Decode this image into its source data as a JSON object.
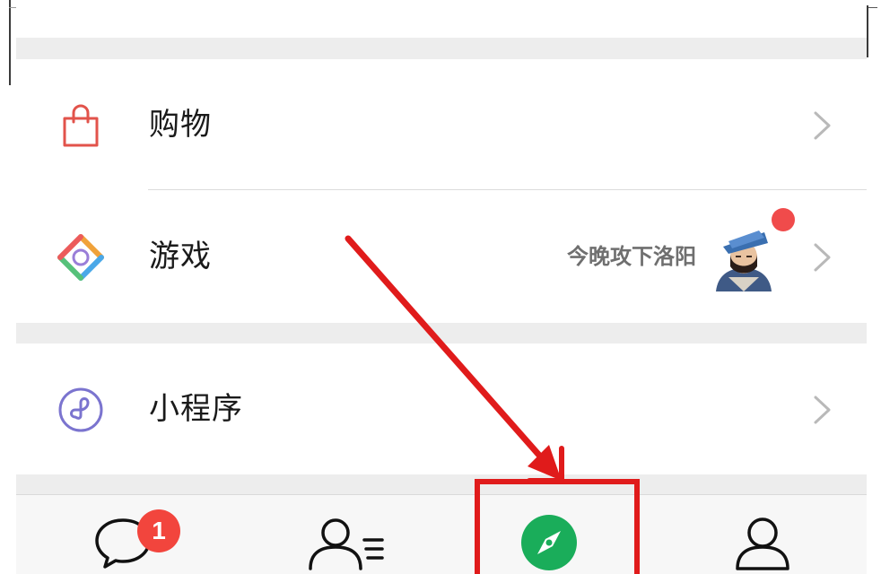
{
  "menu": {
    "items": [
      {
        "label": "购物",
        "icon": "shopping-bag-icon",
        "extra": ""
      },
      {
        "label": "游戏",
        "icon": "game-diamond-icon",
        "extra": "今晚攻下洛阳"
      },
      {
        "label": "小程序",
        "icon": "mini-program-icon",
        "extra": ""
      }
    ]
  },
  "tabbar": {
    "chats_badge": "1",
    "tabs": [
      {
        "icon": "chat-bubble-icon"
      },
      {
        "icon": "contacts-icon"
      },
      {
        "icon": "compass-icon",
        "active": true
      },
      {
        "icon": "profile-icon"
      }
    ]
  },
  "colors": {
    "accent_green": "#1aad5a",
    "badge_red": "#f2453d",
    "highlight_red": "#e01b1b"
  }
}
